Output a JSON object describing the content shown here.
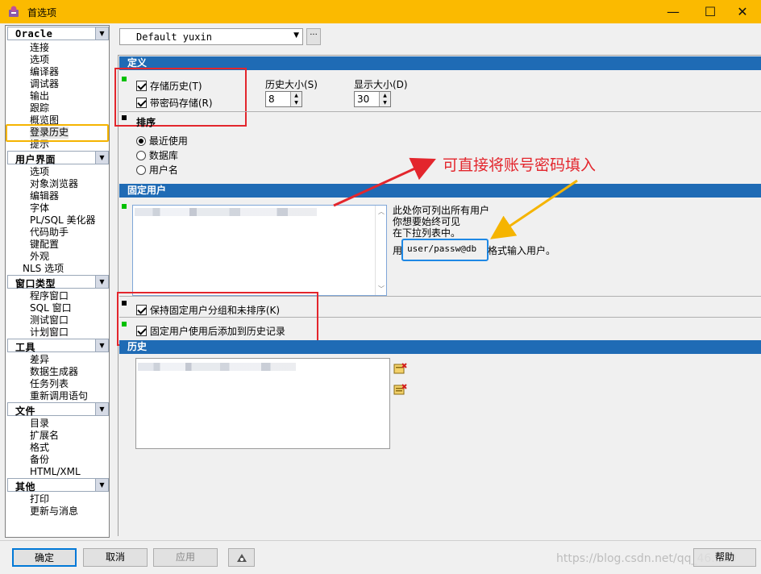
{
  "window": {
    "title": "首选项",
    "minimize": "—",
    "maximize": "☐",
    "close": "✕"
  },
  "nav": {
    "groups": [
      {
        "label": "Oracle",
        "items": [
          "连接",
          "选项",
          "编译器",
          "调试器",
          "输出",
          "跟踪",
          "概览图",
          "登录历史",
          "提示"
        ]
      },
      {
        "label": "用户界面",
        "items": [
          "选项",
          "对象浏览器",
          "编辑器",
          "字体",
          "PL/SQL 美化器",
          "代码助手",
          "键配置",
          "外观",
          "NLS 选项"
        ]
      },
      {
        "label": "窗口类型",
        "items": [
          "程序窗口",
          "SQL 窗口",
          "测试窗口",
          "计划窗口"
        ]
      },
      {
        "label": "工具",
        "items": [
          "差异",
          "数据生成器",
          "任务列表",
          "重新调用语句"
        ]
      },
      {
        "label": "文件",
        "items": [
          "目录",
          "扩展名",
          "格式",
          "备份",
          "HTML/XML"
        ]
      },
      {
        "label": "其他",
        "items": [
          "打印",
          "更新与消息"
        ]
      }
    ],
    "selected": "登录历史"
  },
  "profile": {
    "value": "Default yuxin",
    "more_button": "···"
  },
  "definition": {
    "header": "定义",
    "store_history": "存储历史(T)",
    "store_password": "带密码存储(R)",
    "history_size_label": "历史大小(S)",
    "history_size_value": "8",
    "display_size_label": "显示大小(D)",
    "display_size_value": "30"
  },
  "sort": {
    "header": "排序",
    "options": [
      "最近使用",
      "数据库",
      "用户名"
    ],
    "selected": "最近使用"
  },
  "fixed_users": {
    "header": "固定用户",
    "help_line1": "此处你可列出所有用户",
    "help_line2": "你想要始终可见",
    "help_line3": "在下拉列表中。",
    "help_prefix": "用",
    "format_example": "user/passw@db",
    "help_suffix": "格式输入用户。",
    "keep_sorted": "保持固定用户分组和未排序(K)",
    "add_to_history": "固定用户使用后添加到历史记录"
  },
  "history": {
    "header": "历史"
  },
  "annotation": {
    "text": "可直接将账号密码填入",
    "color": "#e3262d"
  },
  "footer": {
    "ok": "确定",
    "cancel": "取消",
    "apply": "应用",
    "help": "帮助",
    "watermark": "https://blog.csdn.net/qq_46...19"
  },
  "colors": {
    "titlebar": "#fbba00",
    "section_header": "#1f6bb5",
    "highlight_red": "#e3262d",
    "highlight_orange": "#f5b400",
    "highlight_blue": "#1e88e5",
    "green_marker": "#00c000"
  }
}
